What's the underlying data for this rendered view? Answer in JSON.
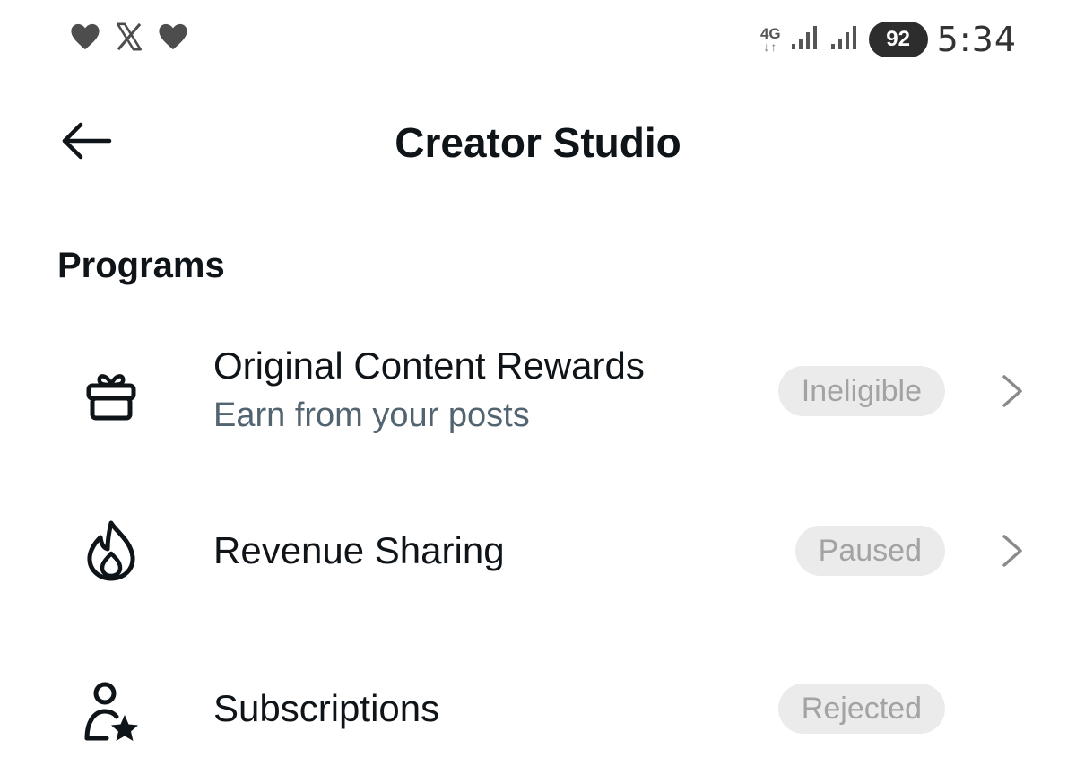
{
  "status_bar": {
    "left_icons": [
      "heart-icon",
      "x-logo-icon",
      "heart-icon"
    ],
    "network_type": "4G",
    "network_arrows": "↓↑",
    "battery_level": "92",
    "time": "5:34"
  },
  "header": {
    "back_icon": "arrow-left-icon",
    "title": "Creator Studio"
  },
  "section": {
    "title": "Programs"
  },
  "programs": [
    {
      "icon": "gift-icon",
      "title": "Original Content Rewards",
      "subtitle": "Earn from your posts",
      "status": "Ineligible",
      "has_chevron": true
    },
    {
      "icon": "flame-icon",
      "title": "Revenue Sharing",
      "status": "Paused",
      "has_chevron": true
    },
    {
      "icon": "person-star-icon",
      "title": "Subscriptions",
      "status": "Rejected",
      "has_chevron": false
    }
  ],
  "colors": {
    "text_primary": "#0f1419",
    "text_secondary": "#536471",
    "badge_bg": "#ebebeb",
    "badge_text": "#a3a3a3",
    "chevron": "#8a8a8a"
  }
}
